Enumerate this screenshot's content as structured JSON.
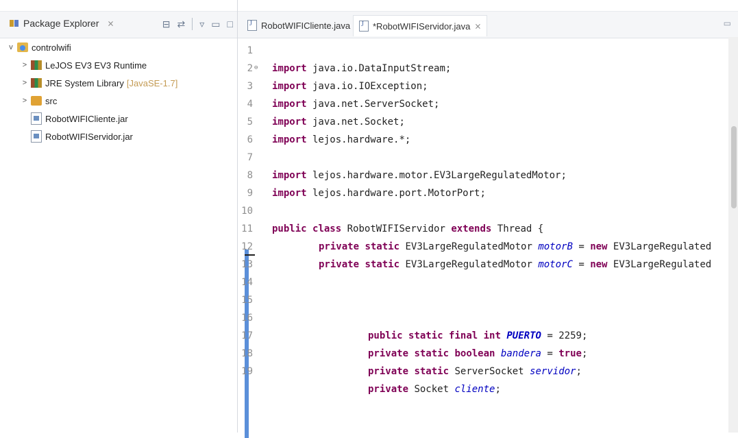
{
  "package_explorer": {
    "title": "Package Explorer",
    "close": "⨯",
    "tree": {
      "project": "controlwifi",
      "items": [
        {
          "label": "LeJOS EV3 EV3 Runtime"
        },
        {
          "label": "JRE System Library",
          "suffix": "[JavaSE-1.7]"
        },
        {
          "label": "src"
        },
        {
          "label": "RobotWIFICliente.jar"
        },
        {
          "label": "RobotWIFIServidor.jar"
        }
      ]
    }
  },
  "editor": {
    "tabs": [
      {
        "label": "RobotWIFICliente.java"
      },
      {
        "label": "*RobotWIFIServidor.java",
        "close": "⨯"
      }
    ],
    "line_numbers": [
      "1",
      "2",
      "3",
      "4",
      "5",
      "6",
      "7",
      "8",
      "9",
      "10",
      "11",
      "12",
      "13",
      "14",
      "15",
      "16",
      "17",
      "18",
      "19"
    ],
    "code": {
      "import_kw": "import",
      "imports": {
        "l2": " java.io.DataInputStream;",
        "l3": " java.io.IOException;",
        "l4": " java.net.ServerSocket;",
        "l5": " java.net.Socket;",
        "l6": " lejos.hardware.*;",
        "l8": " lejos.hardware.motor.EV3LargeRegulatedMotor;",
        "l9": " lejos.hardware.port.MotorPort;"
      },
      "l11": {
        "kw1": "public",
        "kw2": "class",
        "name": " RobotWIFIServidor ",
        "kw3": "extends",
        "rest": " Thread {"
      },
      "l12": {
        "kw1": "private",
        "kw2": "static",
        "type": " EV3LargeRegulatedMotor ",
        "field": "motorB",
        "eq": " = ",
        "kw3": "new",
        "rest": " EV3LargeRegulated"
      },
      "l13": {
        "kw1": "private",
        "kw2": "static",
        "type": " EV3LargeRegulatedMotor ",
        "field": "motorC",
        "eq": " = ",
        "kw3": "new",
        "rest": " EV3LargeRegulated"
      },
      "l16": {
        "kw1": "public",
        "kw2": "static",
        "kw3": "final",
        "kw4": "int",
        "field": "PUERTO",
        "rest": " = 2259;"
      },
      "l17": {
        "kw1": "private",
        "kw2": "static",
        "kw3": "boolean",
        "field": "bandera",
        "eq": " = ",
        "kw4": "true",
        "rest": ";"
      },
      "l18": {
        "kw1": "private",
        "kw2": "static",
        "type": " ServerSocket ",
        "field": "servidor",
        "rest": ";"
      },
      "l19": {
        "kw1": "private",
        "type": " Socket ",
        "field": "cliente",
        "rest": ";"
      }
    }
  }
}
